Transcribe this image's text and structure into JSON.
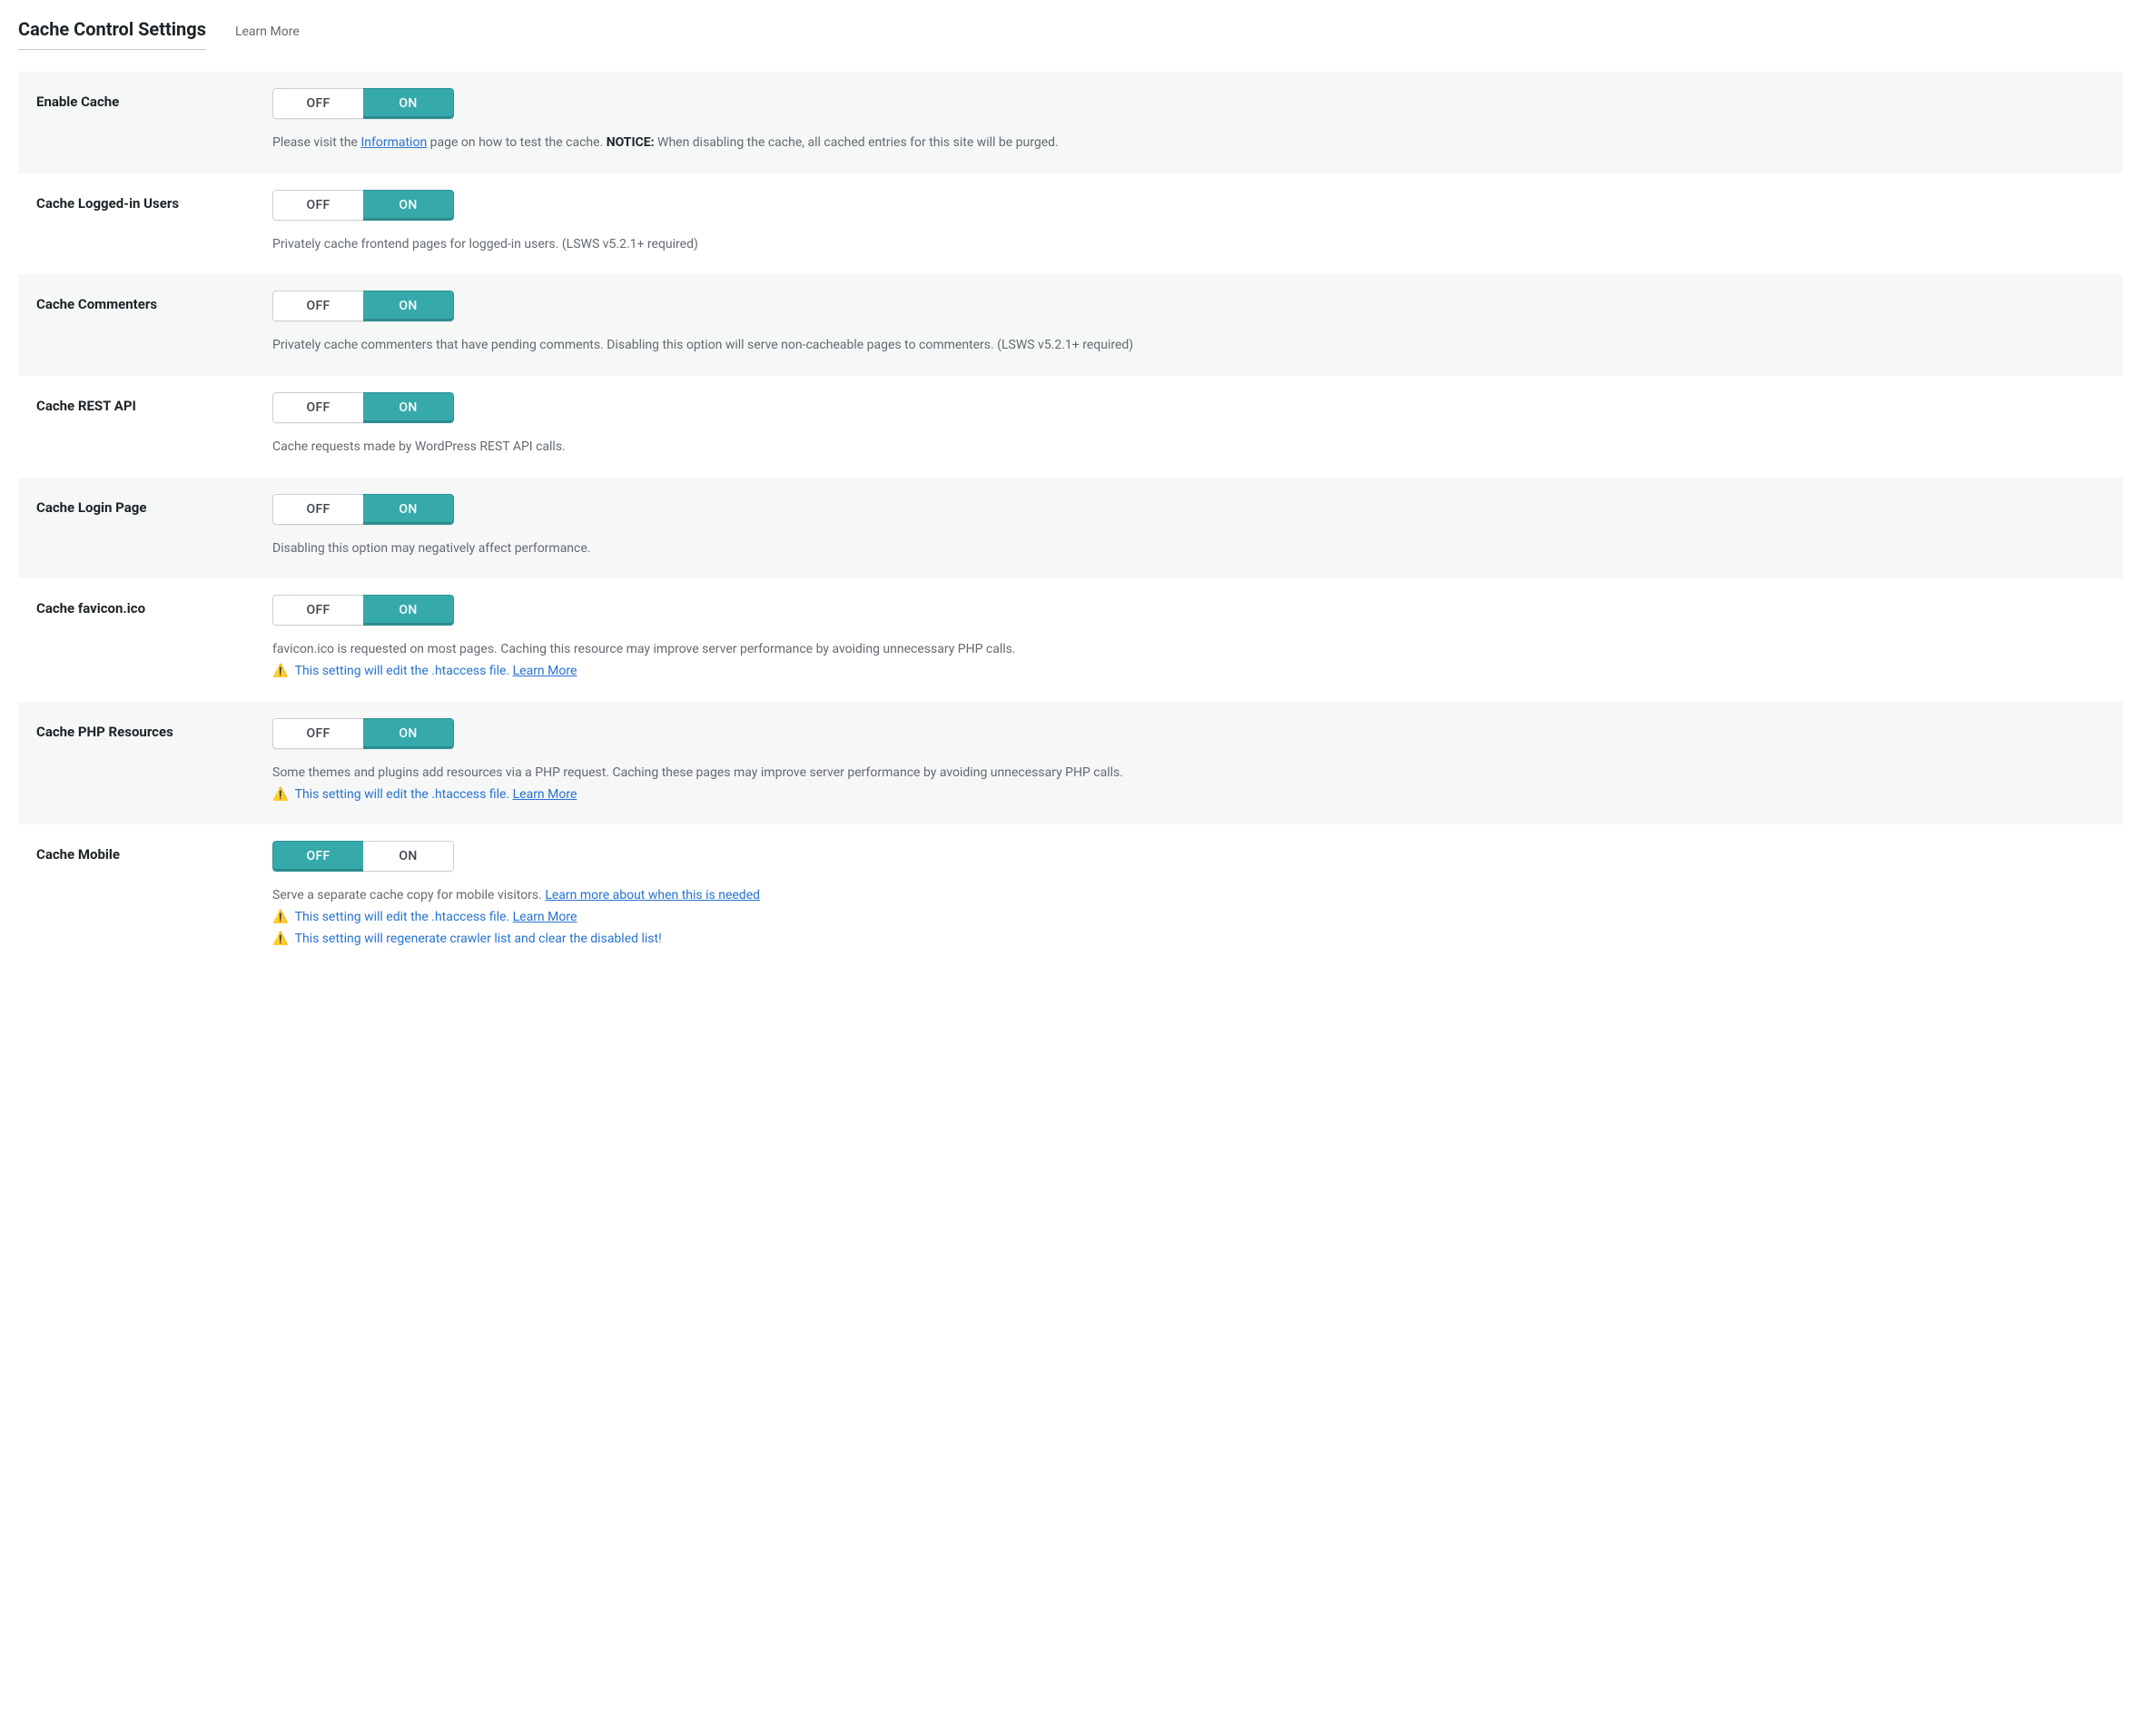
{
  "header": {
    "title": "Cache Control Settings",
    "learn_more": "Learn More"
  },
  "toggle": {
    "off": "OFF",
    "on": "ON"
  },
  "rows": [
    {
      "label": "Enable Cache",
      "value": "on",
      "desc_pre": "Please visit the ",
      "desc_link": "Information",
      "desc_mid": " page on how to test the cache. ",
      "desc_bold": "NOTICE:",
      "desc_post": " When disabling the cache, all cached entries for this site will be purged."
    },
    {
      "label": "Cache Logged-in Users",
      "value": "on",
      "desc": "Privately cache frontend pages for logged-in users. (LSWS v5.2.1+ required)"
    },
    {
      "label": "Cache Commenters",
      "value": "on",
      "desc": "Privately cache commenters that have pending comments. Disabling this option will serve non-cacheable pages to commenters. (LSWS v5.2.1+ required)"
    },
    {
      "label": "Cache REST API",
      "value": "on",
      "desc": "Cache requests made by WordPress REST API calls."
    },
    {
      "label": "Cache Login Page",
      "value": "on",
      "desc": "Disabling this option may negatively affect performance."
    },
    {
      "label": "Cache favicon.ico",
      "value": "on",
      "desc": "favicon.ico is requested on most pages. Caching this resource may improve server performance by avoiding unnecessary PHP calls.",
      "warn_a": "This setting will edit the .htaccess file. ",
      "warn_a_link": "Learn More"
    },
    {
      "label": "Cache PHP Resources",
      "value": "on",
      "desc": "Some themes and plugins add resources via a PHP request. Caching these pages may improve server performance by avoiding unnecessary PHP calls.",
      "warn_a": "This setting will edit the .htaccess file. ",
      "warn_a_link": "Learn More"
    },
    {
      "label": "Cache Mobile",
      "value": "off",
      "desc_pre": "Serve a separate cache copy for mobile visitors. ",
      "desc_link": "Learn more about when this is needed",
      "warn_a": "This setting will edit the .htaccess file. ",
      "warn_a_link": "Learn More",
      "warn_b": "This setting will regenerate crawler list and clear the disabled list!"
    }
  ]
}
